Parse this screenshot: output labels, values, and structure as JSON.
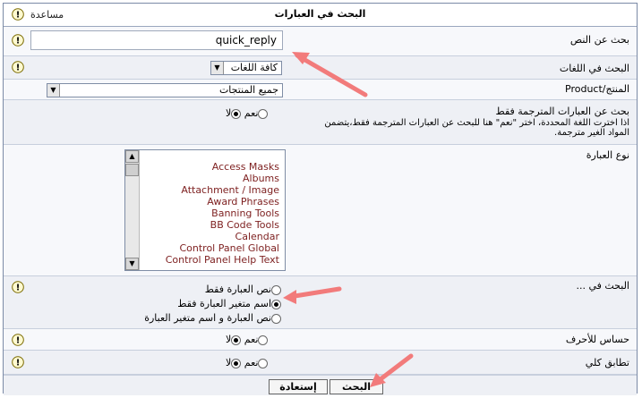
{
  "header": {
    "title": "البحث في العبارات",
    "help": "مساعدة"
  },
  "search_text": {
    "label": "بحث عن النص",
    "value": "quick_reply"
  },
  "language": {
    "label": "البحث في اللغات",
    "selected": "كافة اللغات"
  },
  "product": {
    "label": "المنتج/Product",
    "selected": "جميع المنتجات"
  },
  "translated_only": {
    "title": "بحث عن العبارات المترجمة فقط",
    "description_line1": "اذا اخترت اللغة المحددة، اختر \"نعم\" هنا للبحث عن العبارات المترجمة فقط،يتضمن",
    "description_line2": "المواد الغير مترجمة.",
    "yes": "نعم",
    "no": "لا"
  },
  "phrase_type": {
    "label": "نوع العبارة",
    "items": [
      "Access Masks",
      "Albums",
      "Attachment / Image",
      "Award Phrases",
      "Banning Tools",
      "BB Code Tools",
      "Calendar",
      "Control Panel Global",
      "Control Panel Help Text"
    ]
  },
  "search_in": {
    "label": "البحث في ...",
    "option1": "نص العبارة فقط",
    "option2": "اسم متغير العبارة فقط",
    "option3": "نص العبارة و اسم متغير العبارة"
  },
  "case_sensitive": {
    "label": "حساس للأحرف",
    "yes": "نعم",
    "no": "لا"
  },
  "exact_match": {
    "label": "تطابق كلي",
    "yes": "نعم",
    "no": "لا"
  },
  "buttons": {
    "search": "البحث",
    "reset": "إستعادة"
  },
  "colors": {
    "accent_arrow": "#f27b7b",
    "list_text": "#7d1f1f"
  }
}
